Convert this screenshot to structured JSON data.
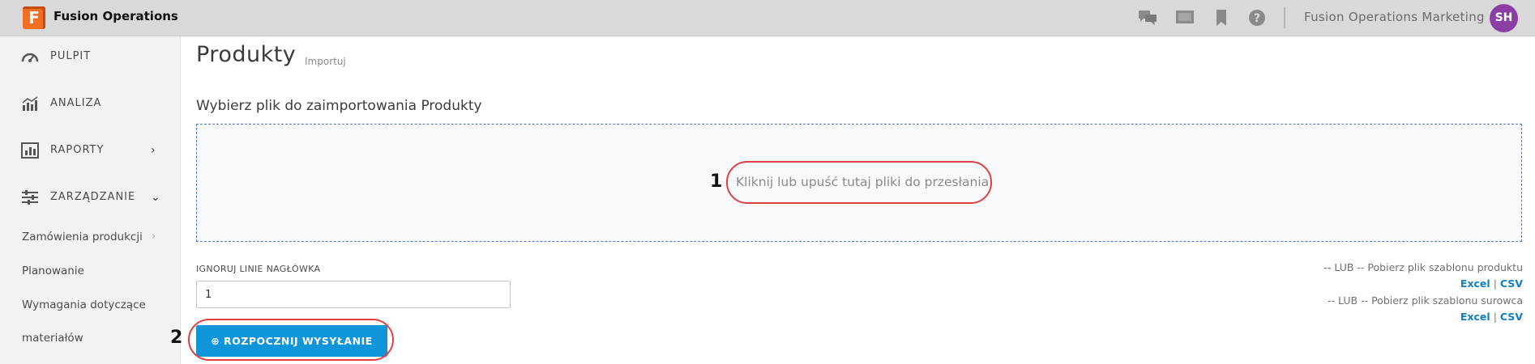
{
  "topbar": {
    "logo_letter": "F",
    "app_name": "Fusion Operations",
    "icons": [
      "chat-icon",
      "monitor-icon",
      "bookmark-icon",
      "help-icon"
    ],
    "tenant": "Fusion Operations Marketing",
    "avatar_initials": "SH",
    "avatar_color": "#8a3ea6"
  },
  "sidebar": {
    "items": [
      {
        "label": "PULPIT",
        "icon": "dashboard-icon"
      },
      {
        "label": "ANALIZA",
        "icon": "analytics-icon"
      },
      {
        "label": "RAPORTY",
        "icon": "reports-icon",
        "chevron": "›"
      },
      {
        "label": "ZARZĄDZANIE",
        "icon": "sliders-icon",
        "chevron": "⌄"
      }
    ],
    "subitems": [
      {
        "label": "Zamówienia produkcji",
        "chevron": "›"
      },
      {
        "label": "Planowanie"
      },
      {
        "label": "Wymagania dotyczące"
      },
      {
        "label": "materiałów"
      }
    ]
  },
  "main": {
    "title": "Produkty",
    "subtitle": "Importuj",
    "section_title": "Wybierz plik do zaimportowania Produkty",
    "dropzone_text": "Kliknij lub upuść tutaj pliki do przesłania",
    "ignore_header_label": "IGNORUJ LINIE NAGŁÓWKA",
    "ignore_header_value": "1",
    "start_button": "⊕ ROZPOCZNIJ WYSYŁANIE",
    "template_product": "-- LUB -- Pobierz plik szablonu produktu",
    "template_raw": "-- LUB -- Pobierz plik szablonu surowca",
    "link_excel": "Excel",
    "link_csv": "CSV",
    "link_sep": "|"
  },
  "annotations": {
    "callout1_number": "1",
    "callout2_number": "2",
    "callout_color": "#e04040"
  },
  "colors": {
    "accent": "#0f95d9",
    "logo": "#f26e22"
  }
}
